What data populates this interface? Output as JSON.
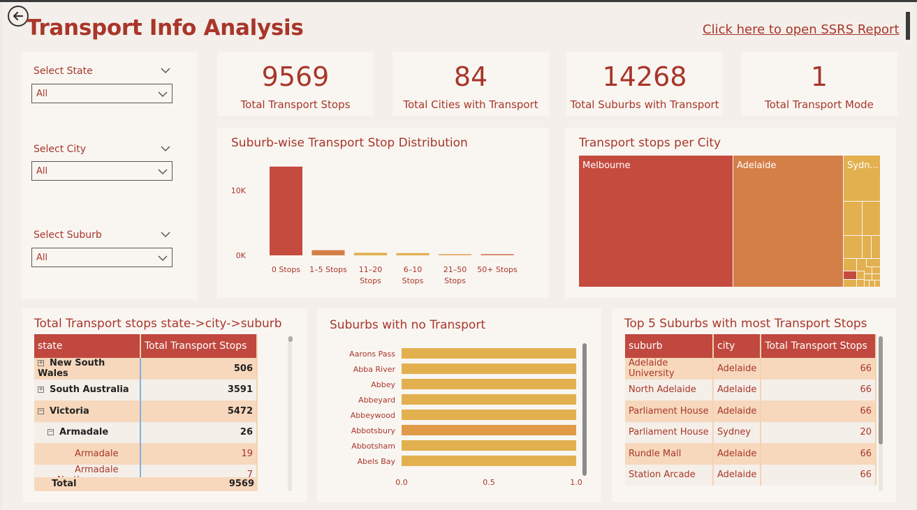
{
  "page": {
    "title": "Transport Info Analysis",
    "ssrs_link": "Click here to open SSRS Report"
  },
  "slicers": {
    "state": {
      "label": "Select State",
      "value": "All"
    },
    "city": {
      "label": "Select City",
      "value": "All"
    },
    "suburb": {
      "label": "Select Suburb",
      "value": "All"
    }
  },
  "kpis": [
    {
      "value": "9569",
      "label": "Total Transport Stops"
    },
    {
      "value": "84",
      "label": "Total Cities with Transport"
    },
    {
      "value": "14268",
      "label": "Total Suburbs with Transport"
    },
    {
      "value": "1",
      "label": "Total Transport Mode"
    }
  ],
  "colors": {
    "accent": "#a8362a",
    "bar_red": "#c54b3f",
    "bar_orange": "#d47e48",
    "bar_gold": "#e3b04f"
  },
  "chart_data": [
    {
      "type": "bar",
      "title": "Suburb-wise Transport Stop Distribution",
      "categories": [
        "0 Stops",
        "1–5 Stops",
        "11–20 Stops",
        "6–10 Stops",
        "21–50 Stops",
        "50+ Stops"
      ],
      "values": [
        13700,
        800,
        400,
        350,
        150,
        180
      ],
      "ylim": [
        0,
        14000
      ],
      "yticks": [
        "0K",
        "10K"
      ],
      "xlabel": "",
      "ylabel": ""
    },
    {
      "type": "treemap",
      "title": "Transport stops per City",
      "labels": [
        "Melbourne",
        "Adelaide",
        "Sydn..."
      ]
    },
    {
      "type": "bar",
      "orientation": "horizontal",
      "title": "Suburbs with no Transport",
      "categories": [
        "Aarons Pass",
        "Abba River",
        "Abbey",
        "Abbeyard",
        "Abbeywood",
        "Abbotsbury",
        "Abbotsham",
        "Abels Bay"
      ],
      "values": [
        1,
        1,
        1,
        1,
        1,
        1,
        1,
        1
      ],
      "xlim": [
        0,
        1
      ],
      "xticks": [
        "0.0",
        "0.5",
        "1.0"
      ]
    }
  ],
  "matrix": {
    "title": "Total Transport stops state->city->suburb",
    "headers": [
      "state",
      "Total Transport Stops"
    ],
    "rows": [
      {
        "label": "New South Wales",
        "value": "506",
        "level": 0,
        "icon": "expand"
      },
      {
        "label": "South Australia",
        "value": "3591",
        "level": 0,
        "icon": "expand"
      },
      {
        "label": "Victoria",
        "value": "5472",
        "level": 0,
        "icon": "collapse"
      },
      {
        "label": "Armadale",
        "value": "26",
        "level": 1,
        "icon": "collapse"
      },
      {
        "label": "Armadale",
        "value": "19",
        "level": 2,
        "icon": ""
      },
      {
        "label": "Armadale North",
        "value": "7",
        "level": 2,
        "icon": ""
      }
    ],
    "total": {
      "label": "Total",
      "value": "9569"
    }
  },
  "top5": {
    "title": "Top 5 Suburbs with most Transport Stops",
    "headers": [
      "suburb",
      "city",
      "Total Transport Stops"
    ],
    "rows": [
      [
        "Adelaide University",
        "Adelaide",
        "66"
      ],
      [
        "North Adelaide",
        "Adelaide",
        "66"
      ],
      [
        "Parliament House",
        "Adelaide",
        "66"
      ],
      [
        "Parliament House",
        "Sydney",
        "20"
      ],
      [
        "Rundle Mall",
        "Adelaide",
        "66"
      ],
      [
        "Station Arcade",
        "Adelaide",
        "66"
      ]
    ]
  }
}
